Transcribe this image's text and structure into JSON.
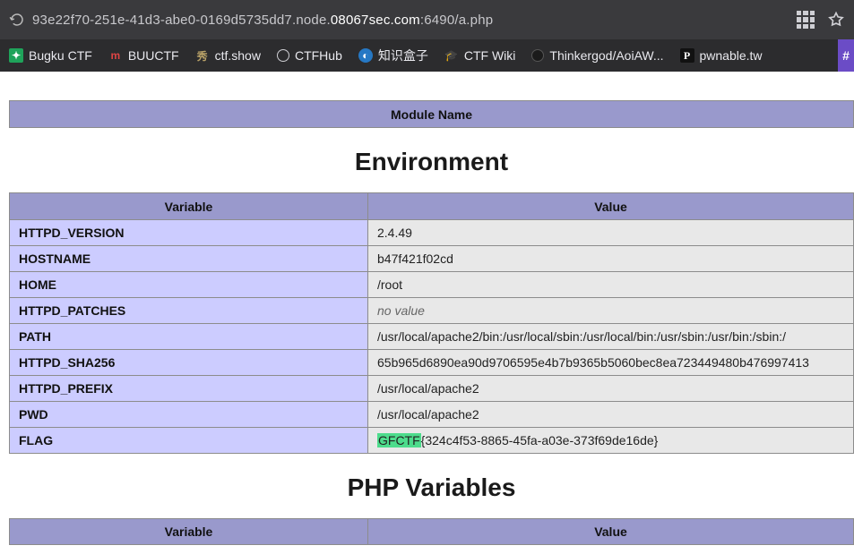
{
  "browser": {
    "url_pre": "93e22f70-251e-41d3-abe0-0169d5735dd7.node.",
    "url_host": "08067sec.com",
    "url_post": ":6490/a.php"
  },
  "bookmarks": [
    {
      "label": "Bugku CTF"
    },
    {
      "label": "BUUCTF"
    },
    {
      "label": "ctf.show"
    },
    {
      "label": "CTFHub"
    },
    {
      "label": "知识盒子"
    },
    {
      "label": "CTF Wiki"
    },
    {
      "label": "Thinkergod/AoiAW..."
    },
    {
      "label": "pwnable.tw"
    }
  ],
  "module": {
    "header": "Module Name"
  },
  "sections": {
    "env": "Environment",
    "phpv": "PHP Variables"
  },
  "env": {
    "headers": {
      "var": "Variable",
      "val": "Value"
    },
    "rows": [
      {
        "k": "HTTPD_VERSION",
        "v": "2.4.49"
      },
      {
        "k": "HOSTNAME",
        "v": "b47f421f02cd"
      },
      {
        "k": "HOME",
        "v": "/root"
      },
      {
        "k": "HTTPD_PATCHES",
        "v": "",
        "novalue": "no value"
      },
      {
        "k": "PATH",
        "v": "/usr/local/apache2/bin:/usr/local/sbin:/usr/local/bin:/usr/sbin:/usr/bin:/sbin:/"
      },
      {
        "k": "HTTPD_SHA256",
        "v": "65b965d6890ea90d9706595e4b7b9365b5060bec8ea723449480b476997413"
      },
      {
        "k": "HTTPD_PREFIX",
        "v": "/usr/local/apache2"
      },
      {
        "k": "PWD",
        "v": "/usr/local/apache2"
      },
      {
        "k": "FLAG",
        "hl": "GFCTF",
        "v": "{324c4f53-8865-45fa-a03e-373f69de16de}"
      }
    ]
  },
  "phpv": {
    "headers": {
      "var": "Variable",
      "val": "Value"
    }
  }
}
